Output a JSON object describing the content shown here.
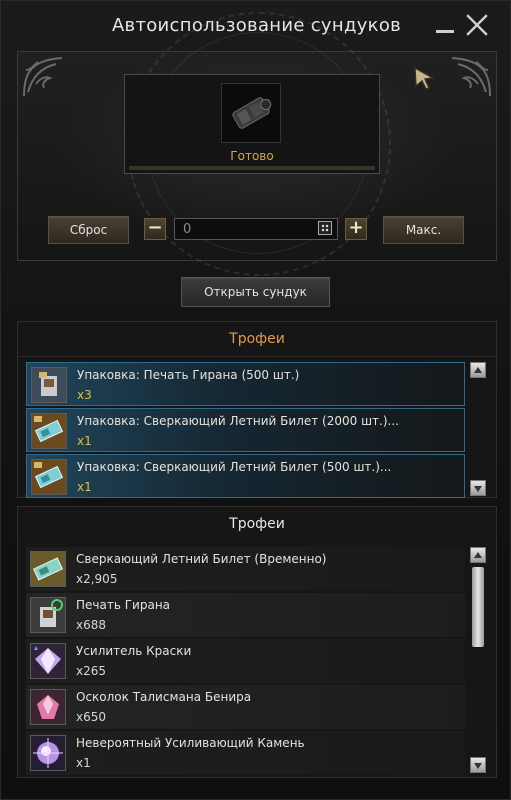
{
  "window": {
    "title": "Автоиспользование сундуков"
  },
  "chest_slot": {
    "icon": "chest-icon",
    "status": "Готово"
  },
  "controls": {
    "reset_label": "Сброс",
    "quantity_value": "0",
    "max_label": "Макс.",
    "open_label": "Открыть сундук"
  },
  "chest_list": {
    "header": "Трофеи",
    "items": [
      {
        "name": "Упаковка: Печать Гирана (500 шт.)",
        "qty": "x3",
        "icon": "giran-seal-pack-icon"
      },
      {
        "name": "Упаковка: Сверкающий Летний Билет (2000 шт.)...",
        "qty": "x1",
        "icon": "summer-ticket-pack-icon"
      },
      {
        "name": "Упаковка: Сверкающий Летний Билет (500 шт.)...",
        "qty": "x1",
        "icon": "summer-ticket-pack-icon"
      }
    ]
  },
  "trophy_list": {
    "header": "Трофеи",
    "items": [
      {
        "name": "Сверкающий Летний Билет (Временно)",
        "qty": "x2,905",
        "icon": "summer-ticket-icon"
      },
      {
        "name": "Печать Гирана",
        "qty": "x688",
        "icon": "giran-seal-icon"
      },
      {
        "name": "Усилитель Краски",
        "qty": "x265",
        "icon": "dye-booster-icon"
      },
      {
        "name": "Осколок Талисмана Бенира",
        "qty": "x650",
        "icon": "talisman-shard-icon"
      },
      {
        "name": "Невероятный Усиливающий Камень",
        "qty": "x1",
        "icon": "enhance-stone-icon"
      }
    ]
  },
  "colors": {
    "accent_orange": "#e19a4b",
    "quantity_gold": "#e0c13f",
    "status_gold": "#d9a441",
    "selection_blue": "#2f6a91"
  }
}
